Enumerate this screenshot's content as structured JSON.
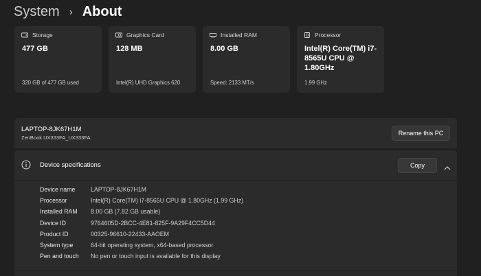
{
  "breadcrumb": {
    "parent": "System",
    "separator": "›",
    "current": "About"
  },
  "cards": [
    {
      "label": "Storage",
      "icon": "storage-icon",
      "value": "477 GB",
      "sub": "320 GB of 477 GB used"
    },
    {
      "label": "Graphics Card",
      "icon": "graphics-card-icon",
      "value": "128 MB",
      "sub": "Intel(R) UHD Graphics 620"
    },
    {
      "label": "Installed RAM",
      "icon": "ram-icon",
      "value": "8.00 GB",
      "sub": "Speed: 2133 MT/s"
    },
    {
      "label": "Processor",
      "icon": "processor-icon",
      "value": "Intel(R) Core(TM) i7-8565U CPU @ 1.80GHz",
      "sub": "1.99 GHz"
    }
  ],
  "pc": {
    "name": "LAPTOP-8JK67H1M",
    "model": "ZenBook UX333FA_UX333FA",
    "rename_label": "Rename this PC"
  },
  "specs": {
    "title": "Device specifications",
    "copy_label": "Copy",
    "rows": [
      {
        "key": "Device name",
        "value": "LAPTOP-8JK67H1M"
      },
      {
        "key": "Processor",
        "value": "Intel(R) Core(TM) i7-8565U CPU @ 1.80GHz (1.99 GHz)"
      },
      {
        "key": "Installed RAM",
        "value": "8.00 GB (7.82 GB usable)"
      },
      {
        "key": "Device ID",
        "value": "9764605D-2BCC-4E81-825F-9A29F4CC5D44"
      },
      {
        "key": "Product ID",
        "value": "00325-96610-22433-AAOEM"
      },
      {
        "key": "System type",
        "value": "64-bit operating system, x64-based processor"
      },
      {
        "key": "Pen and touch",
        "value": "No pen or touch input is available for this display"
      }
    ]
  },
  "colors": {
    "background": "#202020",
    "card": "#2b2b2b",
    "button": "#373737"
  }
}
